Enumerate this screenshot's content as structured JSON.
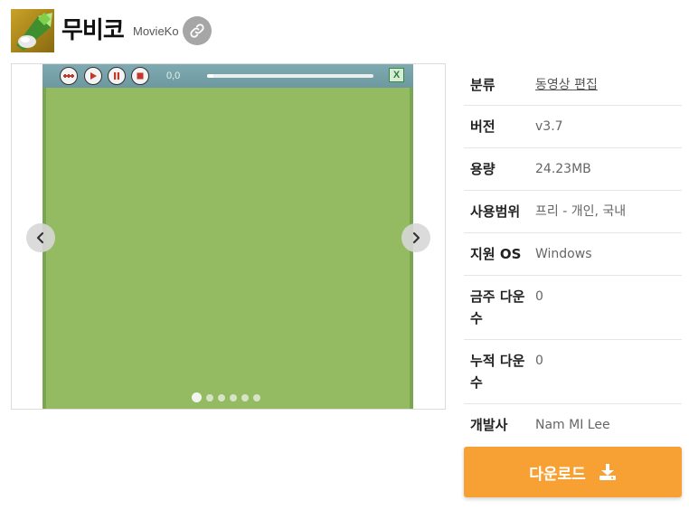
{
  "header": {
    "title": "무비코",
    "subtitle": "MovieKo",
    "link_icon": "link-icon"
  },
  "player": {
    "time": "0,0",
    "progress": 0.04,
    "close_label": "X",
    "buttons": [
      "rewind-icon",
      "play-icon",
      "pause-icon",
      "stop-icon"
    ]
  },
  "carousel": {
    "slide_count": 6,
    "active_index": 0,
    "colors": {
      "video_bg": "#94bb61",
      "player_bar": "#7faab1"
    }
  },
  "info": {
    "rows": [
      {
        "label": "분류",
        "value": "동영상 편집",
        "is_link": true
      },
      {
        "label": "버전",
        "value": "v3.7"
      },
      {
        "label": "용량",
        "value": "24.23MB"
      },
      {
        "label": "사용범위",
        "value": "프리 - 개인, 국내"
      },
      {
        "label": "지원 OS",
        "value": "Windows"
      },
      {
        "label": "금주 다운수",
        "value": "0"
      },
      {
        "label": "누적 다운수",
        "value": "0"
      },
      {
        "label": "개발사",
        "value": "Nam MI Lee"
      }
    ]
  },
  "download": {
    "label": "다운로드",
    "icon": "download-icon",
    "color": "#f7a033"
  }
}
